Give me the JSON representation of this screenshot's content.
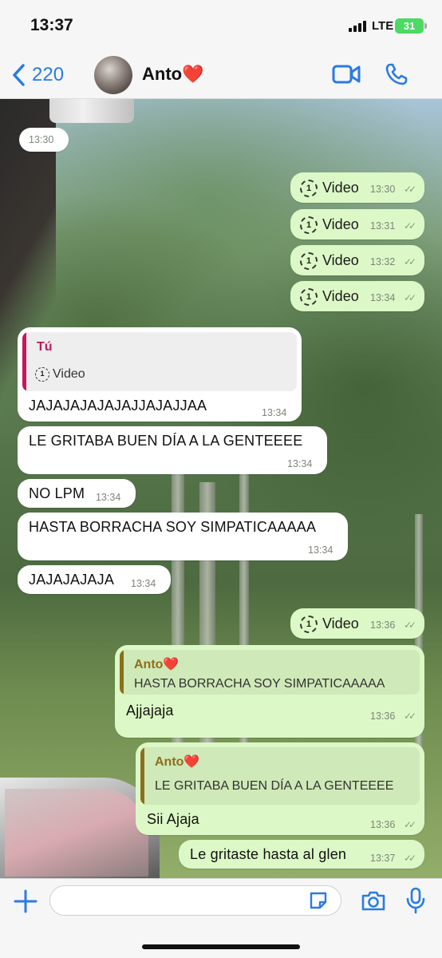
{
  "status_bar": {
    "time": "13:37",
    "network": "LTE",
    "battery": "31"
  },
  "header": {
    "back_count": "220",
    "contact_name": "Anto❤️"
  },
  "messages": {
    "m0": {
      "time": "13:30"
    },
    "m1": {
      "label": "Video",
      "time": "13:30"
    },
    "m2": {
      "label": "Video",
      "time": "13:31"
    },
    "m3": {
      "label": "Video",
      "time": "13:32"
    },
    "m4": {
      "label": "Video",
      "time": "13:34"
    },
    "m5": {
      "quote_author": "Tú",
      "quote_text": "Video",
      "text": "JAJAJAJAJAJAJJAJAJJAA",
      "time": "13:34"
    },
    "m6": {
      "text": "LE GRITABA BUEN DÍA A LA GENTEEEE",
      "time": "13:34"
    },
    "m7": {
      "text": "NO LPM",
      "time": "13:34"
    },
    "m8": {
      "text": "HASTA BORRACHA SOY SIMPATICAAAAA",
      "time": "13:34"
    },
    "m9": {
      "text": "JAJAJAJAJA",
      "time": "13:34"
    },
    "m10": {
      "label": "Video",
      "time": "13:36"
    },
    "m11": {
      "quote_author": "Anto❤️",
      "quote_text": "HASTA BORRACHA SOY SIMPATICAAAAA",
      "text": "Ajjajaja",
      "time": "13:36"
    },
    "m12": {
      "quote_author": "Anto❤️",
      "quote_text": "LE GRITABA BUEN DÍA A LA GENTEEEE",
      "text": "Sii Ajaja",
      "time": "13:36"
    },
    "m13": {
      "text": "Le gritaste hasta al glen",
      "time": "13:37"
    }
  },
  "composer": {
    "placeholder": ""
  },
  "colors": {
    "accent": "#2a7be4",
    "outgoing_bubble": "#dcf8c6",
    "incoming_bubble": "#ffffff",
    "my_quote_bar": "#c2185b",
    "their_quote_bar": "#8d6e1c"
  },
  "icons": [
    "chevron-left-icon",
    "video-camera-icon",
    "phone-icon",
    "view-once-icon",
    "double-check-icon",
    "plus-icon",
    "sticker-icon",
    "camera-icon",
    "microphone-icon"
  ]
}
